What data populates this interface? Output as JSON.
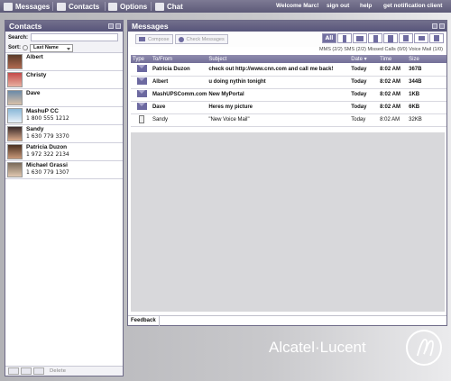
{
  "topbar": {
    "nav": [
      {
        "label": "Messages",
        "icon": "envelope-icon"
      },
      {
        "label": "Contacts",
        "icon": "contact-card-icon"
      },
      {
        "label": "Options",
        "icon": "checkmark-icon"
      },
      {
        "label": "Chat",
        "icon": "chat-bubble-icon"
      }
    ],
    "welcome": "Welcome Marc!",
    "links": [
      "sign out",
      "help",
      "get notification client"
    ]
  },
  "contacts": {
    "title": "Contacts",
    "search_label": "Search:",
    "sort_label": "Sort:",
    "sort_value": "Last Name",
    "items": [
      {
        "name": "Albert",
        "phone": ""
      },
      {
        "name": "Christy",
        "phone": ""
      },
      {
        "name": "Dave",
        "phone": ""
      },
      {
        "name": "MashuP CC",
        "phone": "1 800 555 1212"
      },
      {
        "name": "Sandy",
        "phone": "1 630 779 3370"
      },
      {
        "name": "Patricia Duzon",
        "phone": "1 972 322 2134"
      },
      {
        "name": "Michael Grassi",
        "phone": "1 630 779 1307"
      }
    ],
    "footer_delete": "Delete"
  },
  "messages": {
    "title": "Messages",
    "compose_label": "Compose",
    "check_label": "Check Messages",
    "filter_all": "All",
    "counts": {
      "mms": "MMS (2/2)",
      "sms": "SMS (2/2)",
      "missed": "Missed Calls (0/0)",
      "voicemail": "Voice Mail (1/0)"
    },
    "columns": [
      "Type",
      "To/From",
      "Subject",
      "Date",
      "Time",
      "Size"
    ],
    "rows": [
      {
        "type": "mail",
        "from": "Patricia Duzon",
        "subject": "check out http://www.cnn.com and call me back!",
        "date": "Today",
        "time": "8:02 AM",
        "size": "367B",
        "unread": true
      },
      {
        "type": "mail",
        "from": "Albert",
        "subject": "u doing nythin tonight",
        "date": "Today",
        "time": "8:02 AM",
        "size": "344B",
        "unread": true
      },
      {
        "type": "mail",
        "from": "MashUPSComm.com",
        "subject": "New MyPortal",
        "date": "Today",
        "time": "8:02 AM",
        "size": "1KB",
        "unread": true
      },
      {
        "type": "mail",
        "from": "Dave",
        "subject": "Heres my picture",
        "date": "Today",
        "time": "8:02 AM",
        "size": "6KB",
        "unread": true
      },
      {
        "type": "voicemail",
        "from": "Sandy",
        "subject": "\"New Voice Mail\"",
        "date": "Today",
        "time": "8:02 AM",
        "size": "32KB",
        "unread": false
      }
    ],
    "feedback_label": "Feedback"
  },
  "brand": {
    "logo_text": "Alcatel·Lucent"
  }
}
